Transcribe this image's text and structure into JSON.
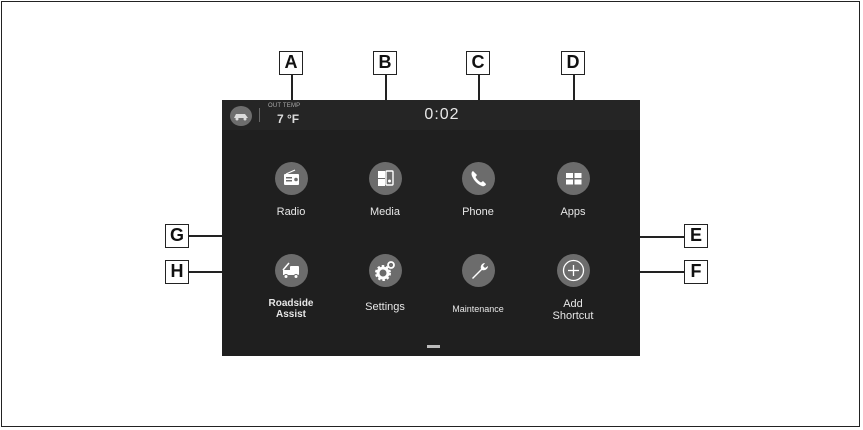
{
  "status_bar": {
    "temp_label": "OUT TEMP",
    "temp_value": "7 °F",
    "clock": "0:02"
  },
  "home_tiles": [
    {
      "label": "Radio",
      "icon": "radio-icon"
    },
    {
      "label": "Media",
      "icon": "media-icon"
    },
    {
      "label": "Phone",
      "icon": "phone-icon"
    },
    {
      "label": "Apps",
      "icon": "apps-icon"
    },
    {
      "label": "Roadside Assist",
      "icon": "tow-truck-icon"
    },
    {
      "label": "Settings",
      "icon": "gears-icon"
    },
    {
      "label": "Maintenance",
      "icon": "wrench-icon"
    },
    {
      "label": "Add Shortcut",
      "icon": "plus-circle-icon"
    }
  ],
  "callouts": [
    "A",
    "B",
    "C",
    "D",
    "E",
    "F",
    "G",
    "H"
  ],
  "colors": {
    "screen": "#1f1f1f",
    "icon_circle": "#6c6c6c",
    "label": "#e6e6e6"
  }
}
